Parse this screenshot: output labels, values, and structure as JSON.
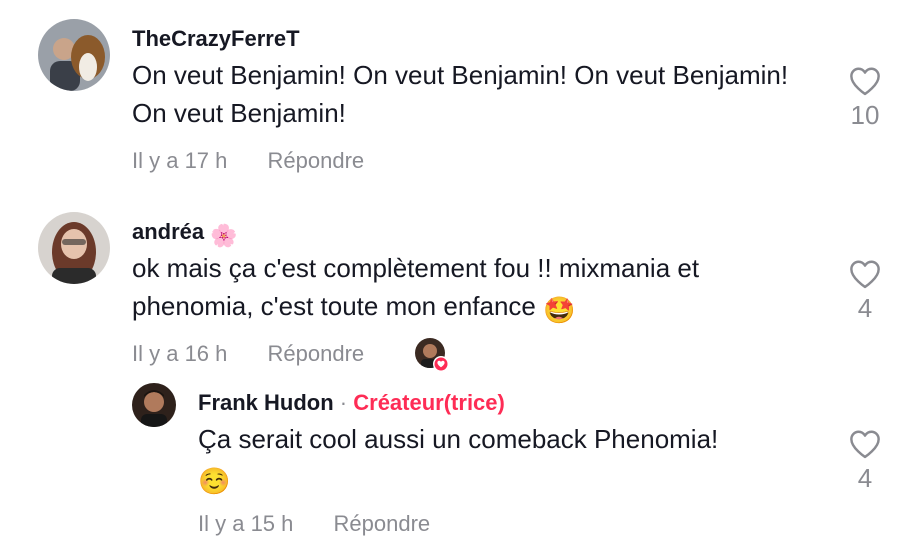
{
  "comments": [
    {
      "username": "TheCrazyFerreT",
      "text": "On veut Benjamin! On veut Benjamin! On veut Benjamin! On veut Benjamin!",
      "time": "Il y a 17 h",
      "reply_label": "Répondre",
      "likes": "10"
    },
    {
      "username": "andréa",
      "username_emoji": "🌸",
      "text": "ok mais ça c'est complètement fou !! mixmania et phenomia, c'est toute mon enfance",
      "text_emoji": "🤩",
      "time": "Il y a 16 h",
      "reply_label": "Répondre",
      "likes": "4"
    }
  ],
  "reply": {
    "username": "Frank Hudon",
    "separator": "·",
    "badge": "Créateur(trice)",
    "text": "Ça serait cool aussi un comeback Phenomia!",
    "text_emoji": "☺️",
    "time": "Il y a 15 h",
    "reply_label": "Répondre",
    "likes": "4"
  },
  "colors": {
    "accent": "#fe2c55",
    "muted": "#8a8b91",
    "text": "#161823"
  },
  "icons": {
    "like": "heart-outline-icon",
    "creator_liked": "heart-badge-icon"
  }
}
